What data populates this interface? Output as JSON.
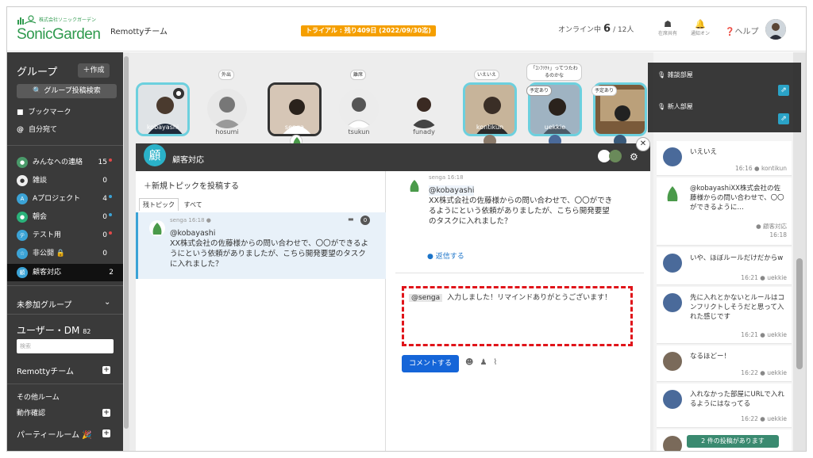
{
  "brand": {
    "logo_sub": "株式会社ソニックガーデン",
    "logo_name": "SonicGarden",
    "team": "Remottyチーム"
  },
  "header": {
    "trial": "トライアル : 残り409日 (2022/09/30迄)",
    "online_label": "オンライン中",
    "online_count": "6",
    "online_total": "/ 12人",
    "icon1": "在席共有",
    "icon2": "通知オン",
    "help": "ヘルプ"
  },
  "sidebar": {
    "title": "グループ",
    "create": "＋作成",
    "search": "グループ投稿検索",
    "links": [
      {
        "label": "ブックマーク",
        "icon": "bookmark-icon"
      },
      {
        "label": "自分宛て",
        "icon": "at-icon"
      }
    ],
    "groups": [
      {
        "label": "みんなへの連絡",
        "count": "15",
        "dot": "#e24a4a"
      },
      {
        "label": "雑談",
        "count": "0",
        "dot": ""
      },
      {
        "label": "Aプロジェクト",
        "count": "4",
        "dot": "#3ba3d6"
      },
      {
        "label": "朝会",
        "count": "0",
        "dot": "#3ba3d6"
      },
      {
        "label": "テスト用",
        "count": "0",
        "dot": "#e24a4a"
      },
      {
        "label": "非公開",
        "count": "0",
        "dot": ""
      },
      {
        "label": "顧客対応",
        "count": "2",
        "dot": ""
      }
    ],
    "unjoined": "未参加グループ",
    "users": "ユーザー・DM",
    "users_count": "82",
    "dm_placeholder": "検索",
    "team_room": "Remottyチーム",
    "other_rooms": "その他ルーム",
    "room1": "動作確認",
    "room2": "パーティールーム"
  },
  "videos": [
    {
      "name": "kobayashi",
      "bubble": ""
    },
    {
      "name": "hosumi",
      "bubble": "外出"
    },
    {
      "name": "senga",
      "bubble": ""
    },
    {
      "name": "tsukun",
      "bubble": "離席"
    },
    {
      "name": "funady",
      "bubble": ""
    },
    {
      "name": "kontikun",
      "bubble": "いえいえ"
    },
    {
      "name": "uekkie",
      "bubble": "「ｺﾝﾌﾘｸﾄ」ってつたわるのかな"
    },
    {
      "name": "",
      "bubble": "予定あり"
    }
  ],
  "tags": {
    "yotei1": "予定あり",
    "yotei2": "予定あり"
  },
  "room": {
    "badge": "顧",
    "title": "顧客対応",
    "new_topic": "＋新規トピックを投稿する",
    "tab1": "残トピック",
    "tab2": "すべて",
    "thread": {
      "user": "senga",
      "time": "16:18",
      "mention": "@kobayashi",
      "text": "XX株式会社の佐藤様からの問い合わせで、〇〇ができるようにという依頼がありましたが、こちら開発要望のタスクに入れました？"
    },
    "detail": {
      "user": "senga",
      "time": "16:18",
      "mention": "@kobayashi",
      "text": "XX株式会社の佐藤様からの問い合わせで、〇〇ができるようにという依頼がありましたが、こちら開発要望のタスクに入れました？",
      "reply": "返信する"
    },
    "compose": {
      "tag": "@senga",
      "text": "入力しました！リマインドありがとうございます！"
    },
    "send": "コメントする"
  },
  "rooms_popup": {
    "room1": "雑談部屋",
    "room2": "新人部屋"
  },
  "feed": [
    {
      "text": "いえいえ",
      "time": "16:16",
      "user": "kontikun"
    },
    {
      "text": "@kobayashiXX株式会社の佐藤様からの問い合わせで、〇〇ができるように…",
      "time": "16:18",
      "user": "顧客対応"
    },
    {
      "text": "いや、ほぼルールだけだからw",
      "time": "16:21",
      "user": "uekkie"
    },
    {
      "text": "先に入れとかないとルールはコンフリクトしそうだと思って入れた感じです",
      "time": "16:21",
      "user": "uekkie"
    },
    {
      "text": "なるほどー！",
      "time": "16:22",
      "user": "uekkie"
    },
    {
      "text": "入れなかった部屋にURLで入れるようにはなってる",
      "time": "16:22",
      "user": "uekkie"
    }
  ],
  "new_posts": "2 件の投稿があります",
  "colors": {
    "accent": "#2ab2c9",
    "sidebar": "#3a3a3a",
    "send": "#1565d8",
    "trial": "#f59f00"
  }
}
